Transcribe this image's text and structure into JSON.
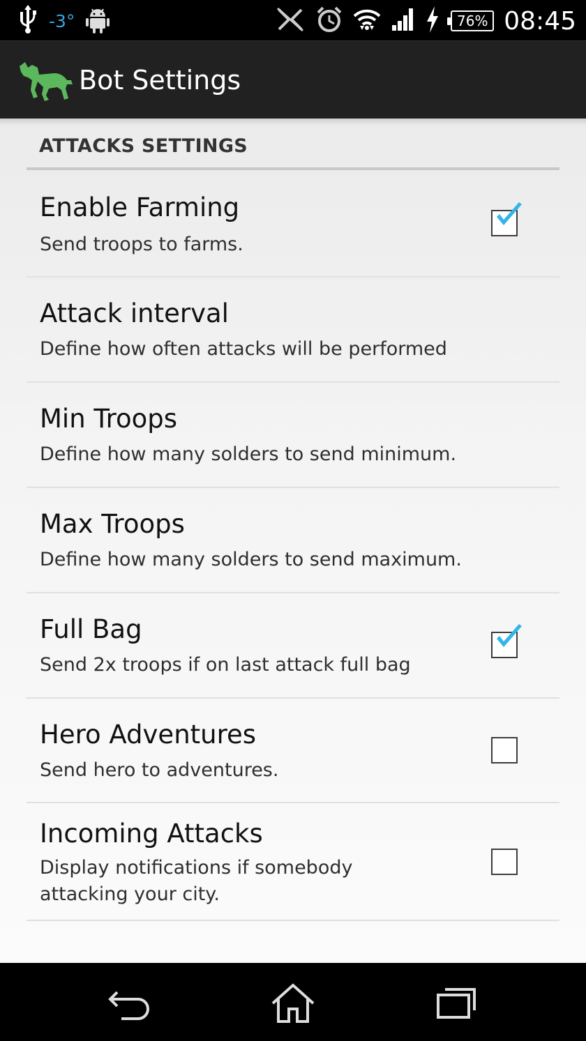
{
  "status_bar": {
    "temperature": "-3°",
    "battery": "76%",
    "time": "08:45"
  },
  "action_bar": {
    "title": "Bot Settings",
    "logo_color": "#5cb85c"
  },
  "section": {
    "header": "ATTACKS SETTINGS"
  },
  "preferences": [
    {
      "title": "Enable Farming",
      "summary": "Send troops to farms.",
      "has_checkbox": true,
      "checked": true
    },
    {
      "title": "Attack interval",
      "summary": "Define how often attacks will be performed",
      "has_checkbox": false
    },
    {
      "title": "Min Troops",
      "summary": "Define how many solders to send minimum.",
      "has_checkbox": false
    },
    {
      "title": "Max Troops",
      "summary": "Define how many solders to send maximum.",
      "has_checkbox": false
    },
    {
      "title": "Full Bag",
      "summary": "Send 2x troops if on last attack full bag",
      "has_checkbox": true,
      "checked": true
    },
    {
      "title": "Hero Adventures",
      "summary": "Send hero to adventures.",
      "has_checkbox": true,
      "checked": false
    },
    {
      "title": "Incoming Attacks",
      "summary": "Display notifications if somebody attacking your city.",
      "has_checkbox": true,
      "checked": false
    }
  ],
  "colors": {
    "check_mark": "#33b5e5",
    "action_bar_bg": "#212121"
  },
  "icons": {
    "usb": "usb-icon",
    "android": "android-icon",
    "nfc": "nfc-off-icon",
    "alarm": "alarm-icon",
    "wifi": "wifi-icon",
    "signal": "signal-icon",
    "charging": "charging-icon",
    "back": "back-icon",
    "home": "home-icon",
    "recents": "recents-icon"
  }
}
